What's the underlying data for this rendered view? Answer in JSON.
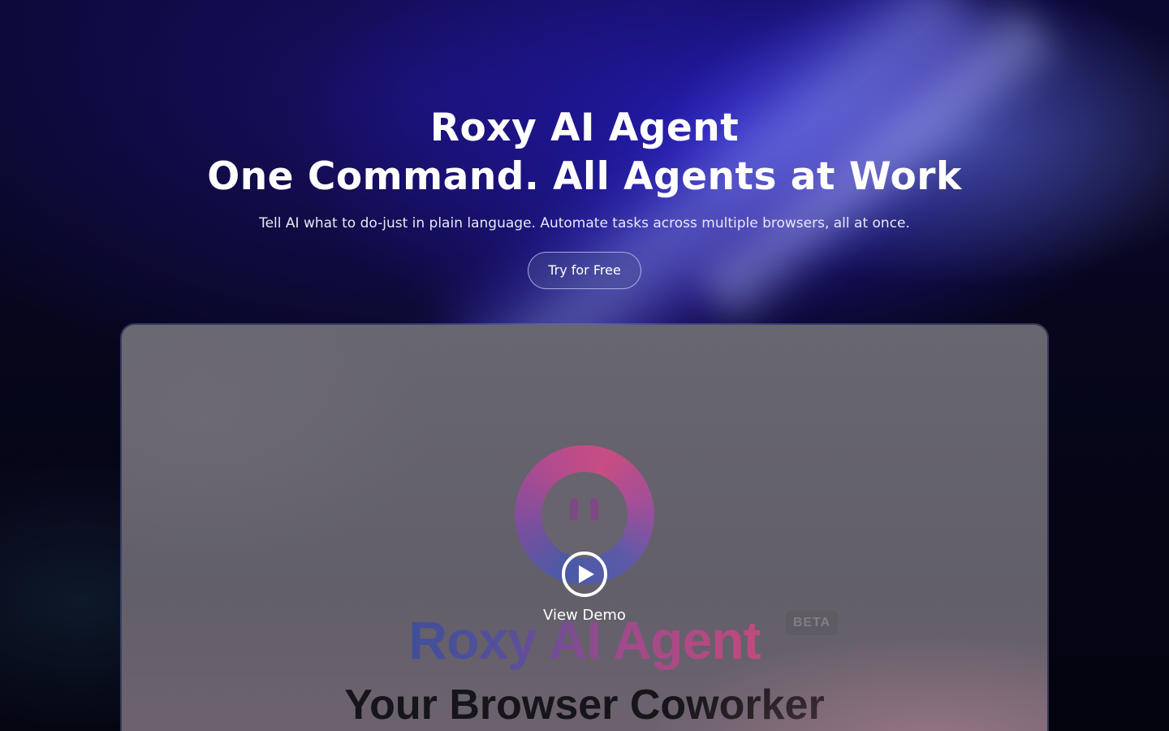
{
  "hero": {
    "title_line1": "Roxy AI Agent",
    "title_line2": "One Command. All Agents at Work",
    "subtitle": "Tell AI what to do-just in plain language. Automate tasks across multiple browsers, all at once.",
    "cta_label": "Try for Free"
  },
  "demo": {
    "video_title": "Roxy AI Agent",
    "badge": "BETA",
    "tagline": "Your Browser Coworker",
    "play_label": "View Demo",
    "icons": [
      "roxy-logo-icon",
      "play-icon"
    ]
  },
  "colors": {
    "background": "#04040f",
    "accent_blue": "#261cbe",
    "brand_gradient_start": "#3f4f9a",
    "brand_gradient_end": "#c24a7c"
  }
}
